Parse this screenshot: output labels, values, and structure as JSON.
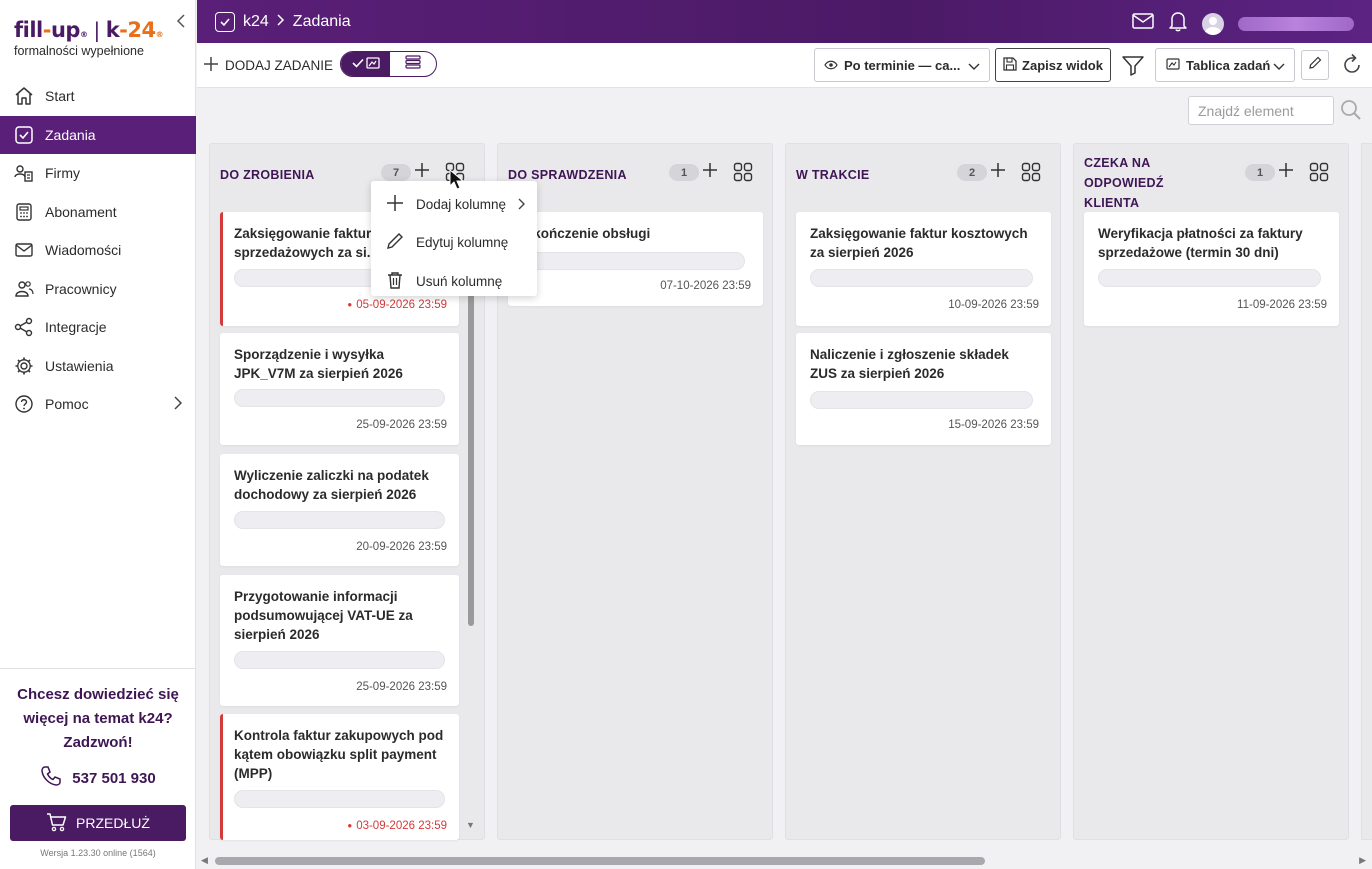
{
  "logo": {
    "part1": "fill",
    "dash": "-",
    "part2": "up",
    "reg": "®",
    "sep": "|",
    "k": "k",
    "num": "-24",
    "reg2": "®",
    "tagline": "formalności wypełnione"
  },
  "sidebar": {
    "items": [
      {
        "label": "Start",
        "icon": "home-icon"
      },
      {
        "label": "Zadania",
        "icon": "checkbox-icon",
        "active": true
      },
      {
        "label": "Firmy",
        "icon": "companies-icon"
      },
      {
        "label": "Abonament",
        "icon": "calculator-icon"
      },
      {
        "label": "Wiadomości",
        "icon": "mail-icon"
      },
      {
        "label": "Pracownicy",
        "icon": "users-icon"
      },
      {
        "label": "Integracje",
        "icon": "share-icon"
      },
      {
        "label": "Ustawienia",
        "icon": "gear-icon"
      },
      {
        "label": "Pomoc",
        "icon": "help-icon"
      }
    ],
    "promo_text": "Chcesz dowiedzieć się więcej na temat k24? Zadzwoń!",
    "phone": "537 501 930",
    "renew_label": "PRZEDŁUŻ",
    "version": "Wersja 1.23.30 online (1564)"
  },
  "header": {
    "breadcrumb_root": "k24",
    "breadcrumb_current": "Zadania"
  },
  "toolbar": {
    "add_task": "DODAJ ZADANIE",
    "sort_value": "Po terminie — ca...",
    "save_view": "Zapisz widok",
    "board_select": "Tablica zadań"
  },
  "search": {
    "placeholder": "Znajdź element"
  },
  "columns": [
    {
      "title": "DO ZROBIENIA",
      "count": "7",
      "cards": [
        {
          "title": "Zaksięgowanie faktur sprzedażowych za si...",
          "date": "05-09-2026 23:59",
          "overdue": true
        },
        {
          "title": "Sporządzenie i wysyłka JPK_V7M za sierpień 2026",
          "date": "25-09-2026 23:59"
        },
        {
          "title": "Wyliczenie zaliczki na podatek dochodowy za sierpień 2026",
          "date": "20-09-2026 23:59"
        },
        {
          "title": "Przygotowanie informacji podsumowującej VAT-UE za sierpień 2026",
          "date": "25-09-2026 23:59"
        },
        {
          "title": "Kontrola faktur zakupowych pod kątem obowiązku split payment (MPP)",
          "date": "03-09-2026 23:59",
          "overdue": true
        }
      ]
    },
    {
      "title": "DO SPRAWDZENIA",
      "count": "1",
      "cards": [
        {
          "title": "...kończenie obsługi",
          "date": "07-10-2026 23:59"
        }
      ]
    },
    {
      "title": "W TRAKCIE",
      "count": "2",
      "cards": [
        {
          "title": "Zaksięgowanie faktur kosztowych za sierpień 2026",
          "date": "10-09-2026 23:59"
        },
        {
          "title": "Naliczenie i zgłoszenie składek ZUS za sierpień 2026",
          "date": "15-09-2026 23:59"
        }
      ]
    },
    {
      "title": "CZEKA NA ODPOWIEDŹ KLIENTA",
      "count": "1",
      "cards": [
        {
          "title": "Weryfikacja płatności za faktury sprzedażowe (termin 30 dni)",
          "date": "11-09-2026 23:59"
        }
      ]
    }
  ],
  "column_menu": {
    "items": [
      {
        "label": "Dodaj kolumnę",
        "icon": "plus-icon"
      },
      {
        "label": "Edytuj kolumnę",
        "icon": "pencil-icon"
      },
      {
        "label": "Usuń kolumnę",
        "icon": "trash-icon"
      }
    ]
  },
  "colors": {
    "brand": "#4a1a62",
    "accent": "#e8701a",
    "overdue": "#d33a3a"
  }
}
